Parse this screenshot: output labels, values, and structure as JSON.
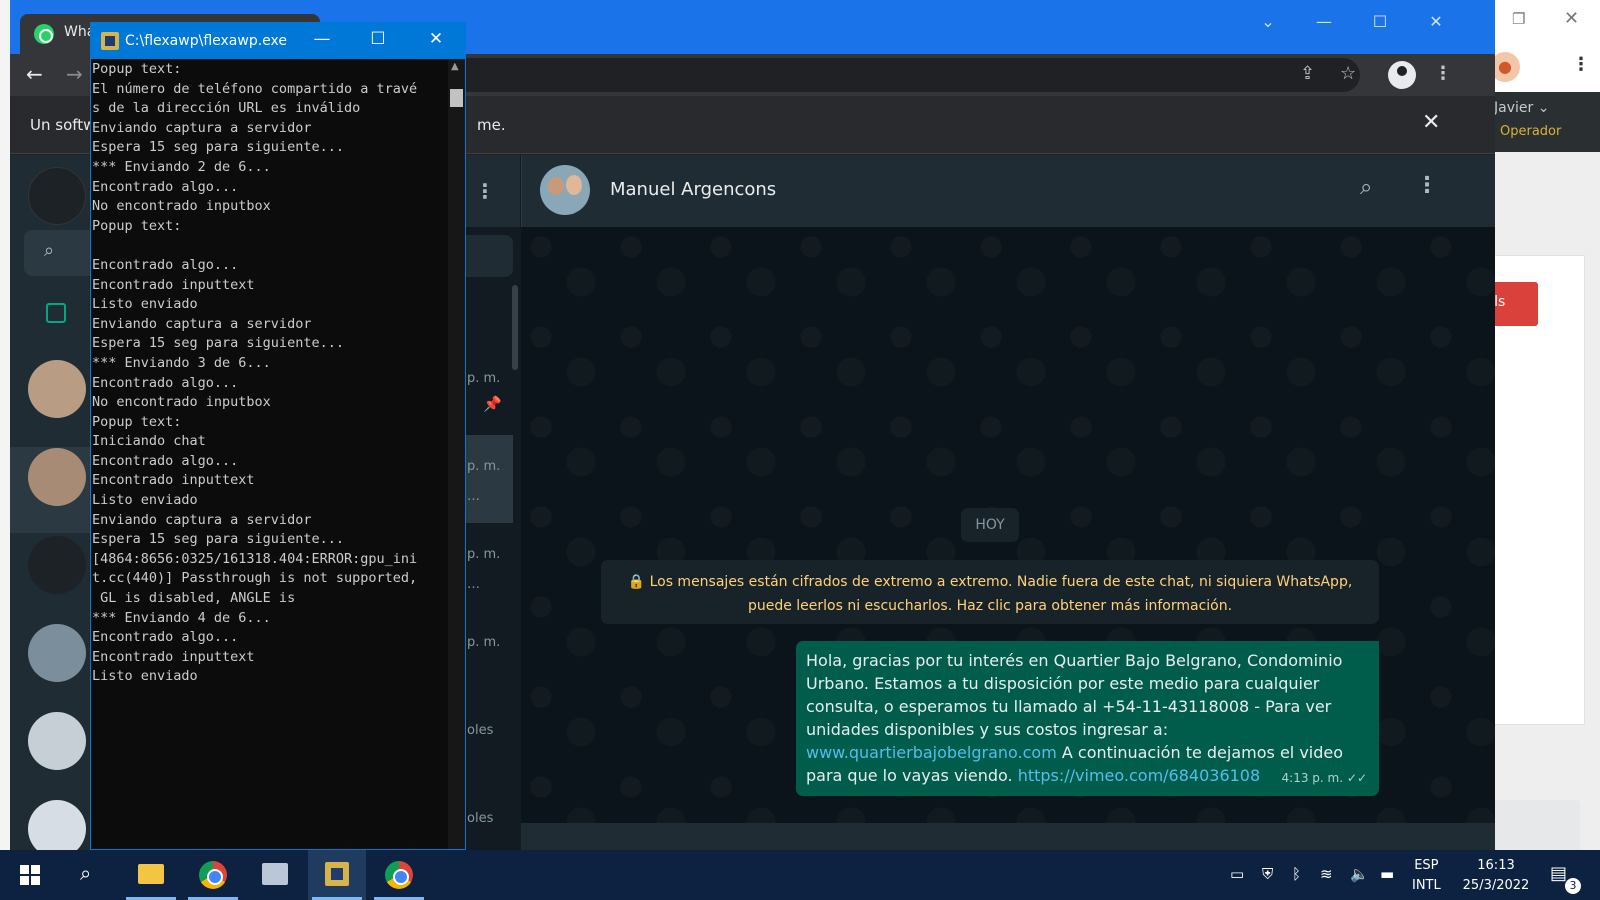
{
  "background_app": {
    "user_name": "Javier ⌄",
    "user_role": "Operador",
    "button_label": "mails"
  },
  "chrome": {
    "tab_title": "Wha",
    "infobar_left": "Un softw",
    "infobar_right": "me."
  },
  "whatsapp": {
    "contact_name": "Manuel Argencons",
    "sidebar_times": [
      "p. m.",
      "p. m.",
      "p. m.",
      "p. m.",
      "oles",
      "oles"
    ],
    "sidebar_ellipsis": [
      "…",
      "…"
    ],
    "date_chip": "HOY",
    "encryption_notice": "🔒 Los mensajes están cifrados de extremo a extremo. Nadie fuera de este chat, ni siquiera WhatsApp, puede leerlos ni escucharlos. Haz clic para obtener más información.",
    "message": {
      "text_1": "Hola, gracias por tu interés en Quartier Bajo Belgrano, Condominio Urbano. Estamos a tu disposición por este medio para cualquier consulta, o esperamos tu llamado al +54-11-43118008  - Para ver unidades disponibles y sus costos ingresar a:",
      "link_1": "www.quartierbajobelgrano.com",
      "text_2": " A continuación te dejamos el video para que lo vayas viendo. ",
      "link_2": "https://vimeo.com/684036108",
      "time": "4:13 p. m.",
      "ticks": "✓✓"
    }
  },
  "console": {
    "title": "C:\\flexawp\\flexawp.exe",
    "lines": [
      "Popup text:",
      "El número de teléfono compartido a travé",
      "s de la dirección URL es inválido",
      "Enviando captura a servidor",
      "Espera 15 seg para siguiente...",
      "*** Enviando 2 de 6...",
      "Encontrado algo...",
      "No encontrado inputbox",
      "Popup text:",
      "",
      "Encontrado algo...",
      "Encontrado inputtext",
      "Listo enviado",
      "Enviando captura a servidor",
      "Espera 15 seg para siguiente...",
      "*** Enviando 3 de 6...",
      "Encontrado algo...",
      "No encontrado inputbox",
      "Popup text:",
      "Iniciando chat",
      "Encontrado algo...",
      "Encontrado inputtext",
      "Listo enviado",
      "Enviando captura a servidor",
      "Espera 15 seg para siguiente...",
      "[4864:8656:0325/161318.404:ERROR:gpu_ini",
      "t.cc(440)] Passthrough is not supported,",
      " GL is disabled, ANGLE is",
      "*** Enviando 4 de 6...",
      "Encontrado algo...",
      "Encontrado inputtext",
      "Listo enviado"
    ]
  },
  "taskbar": {
    "lang_1": "ESP",
    "lang_2": "INTL",
    "time": "16:13",
    "date": "25/3/2022",
    "notification_count": "3"
  }
}
